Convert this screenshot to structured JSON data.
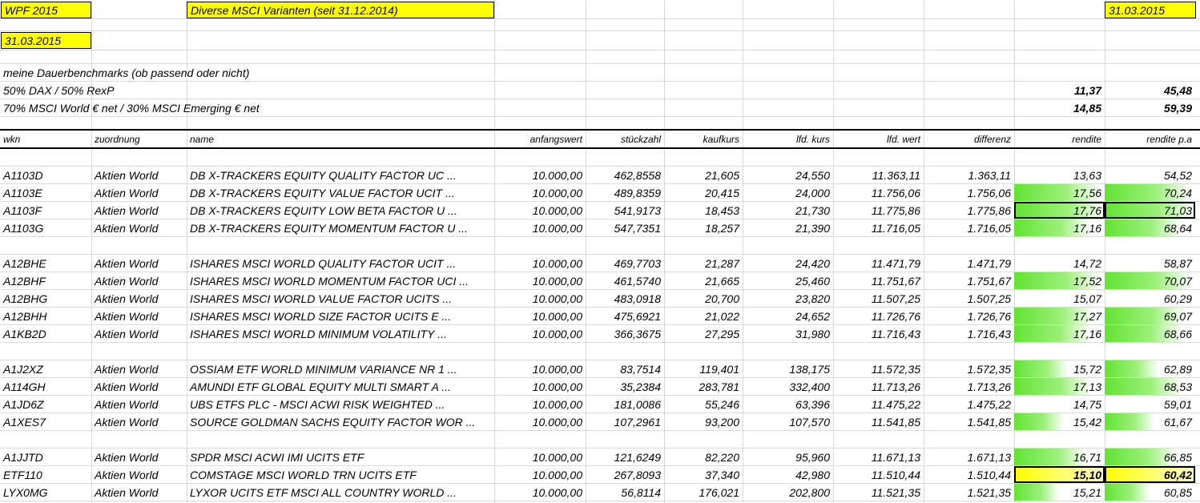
{
  "top": {
    "title": "WPF 2015",
    "subtitle": "Diverse MSCI Varianten (seit 31.12.2014)",
    "date_right": "31.03.2015",
    "date_left": "31.03.2015"
  },
  "benchmarks": {
    "heading": "meine Dauerbenchmarks (ob passend oder nicht)",
    "items": [
      {
        "label": "50% DAX / 50% RexP",
        "rendite": "11,37",
        "rendite_pa": "45,48"
      },
      {
        "label": "70% MSCI World € net / 30% MSCI Emerging € net",
        "rendite": "14,85",
        "rendite_pa": "59,39"
      }
    ]
  },
  "columns": {
    "wkn": "wkn",
    "zuordnung": "zuordnung",
    "name": "name",
    "anfangswert": "anfangswert",
    "stueckzahl": "stückzahl",
    "kaufkurs": "kaufkurs",
    "lfd_kurs": "lfd. kurs",
    "lfd_wert": "lfd. wert",
    "differenz": "differenz",
    "rendite": "rendite",
    "rendite_pa": "rendite p.a"
  },
  "rows": [
    {
      "wkn": "A1103D",
      "zuordnung": "Aktien World",
      "name": "DB X-TRACKERS EQUITY QUALITY FACTOR UC ...",
      "anfangswert": "10.000,00",
      "stueck": "462,8558",
      "kaufkurs": "21,605",
      "lfdkurs": "24,550",
      "lfdwert": "11.363,11",
      "diff": "1.363,11",
      "rendite": "13,63",
      "renditepa": "54,52",
      "fill": 0
    },
    {
      "wkn": "A1103E",
      "zuordnung": "Aktien World",
      "name": "DB X-TRACKERS EQUITY VALUE FACTOR UCIT ...",
      "anfangswert": "10.000,00",
      "stueck": "489,8359",
      "kaufkurs": "20,415",
      "lfdkurs": "24,000",
      "lfdwert": "11.756,06",
      "diff": "1.756,06",
      "rendite": "17,56",
      "renditepa": "70,24",
      "fill": 0.95
    },
    {
      "wkn": "A1103F",
      "zuordnung": "Aktien World",
      "name": "DB X-TRACKERS EQUITY LOW BETA FACTOR U ...",
      "anfangswert": "10.000,00",
      "stueck": "541,9173",
      "kaufkurs": "18,453",
      "lfdkurs": "21,730",
      "lfdwert": "11.775,86",
      "diff": "1.775,86",
      "rendite": "17,76",
      "renditepa": "71,03",
      "fill": 1
    },
    {
      "wkn": "A1103G",
      "zuordnung": "Aktien World",
      "name": "DB X-TRACKERS EQUITY MOMENTUM FACTOR U ...",
      "anfangswert": "10.000,00",
      "stueck": "547,7351",
      "kaufkurs": "18,257",
      "lfdkurs": "21,390",
      "lfdwert": "11.716,05",
      "diff": "1.716,05",
      "rendite": "17,16",
      "renditepa": "68,64",
      "fill": 0.85
    },
    null,
    {
      "wkn": "A12BHE",
      "zuordnung": "Aktien World",
      "name": "ISHARES MSCI WORLD QUALITY FACTOR UCIT ...",
      "anfangswert": "10.000,00",
      "stueck": "469,7703",
      "kaufkurs": "21,287",
      "lfdkurs": "24,420",
      "lfdwert": "11.471,79",
      "diff": "1.471,79",
      "rendite": "14,72",
      "renditepa": "58,87",
      "fill": 0
    },
    {
      "wkn": "A12BHF",
      "zuordnung": "Aktien World",
      "name": "ISHARES MSCI WORLD MOMENTUM FACTOR UCI ...",
      "anfangswert": "10.000,00",
      "stueck": "461,5740",
      "kaufkurs": "21,665",
      "lfdkurs": "25,460",
      "lfdwert": "11.751,67",
      "diff": "1.751,67",
      "rendite": "17,52",
      "renditepa": "70,07",
      "fill": 0.95
    },
    {
      "wkn": "A12BHG",
      "zuordnung": "Aktien World",
      "name": "ISHARES MSCI WORLD VALUE FACTOR UCITS ...",
      "anfangswert": "10.000,00",
      "stueck": "483,0918",
      "kaufkurs": "20,700",
      "lfdkurs": "23,820",
      "lfdwert": "11.507,25",
      "diff": "1.507,25",
      "rendite": "15,07",
      "renditepa": "60,29",
      "fill": 0
    },
    {
      "wkn": "A12BHH",
      "zuordnung": "Aktien World",
      "name": "ISHARES MSCI WORLD SIZE FACTOR UCITS E ...",
      "anfangswert": "10.000,00",
      "stueck": "475,6921",
      "kaufkurs": "21,022",
      "lfdkurs": "24,652",
      "lfdwert": "11.726,76",
      "diff": "1.726,76",
      "rendite": "17,27",
      "renditepa": "69,07",
      "fill": 0.88
    },
    {
      "wkn": "A1KB2D",
      "zuordnung": "Aktien World",
      "name": "ISHARES MSCI WORLD MINIMUM VOLATILITY ...",
      "anfangswert": "10.000,00",
      "stueck": "366,3675",
      "kaufkurs": "27,295",
      "lfdkurs": "31,980",
      "lfdwert": "11.716,43",
      "diff": "1.716,43",
      "rendite": "17,16",
      "renditepa": "68,66",
      "fill": 0.85
    },
    null,
    {
      "wkn": "A1J2XZ",
      "zuordnung": "Aktien World",
      "name": "OSSIAM ETF WORLD MINIMUM VARIANCE NR 1 ...",
      "anfangswert": "10.000,00",
      "stueck": "83,7514",
      "kaufkurs": "119,401",
      "lfdkurs": "138,175",
      "lfdwert": "11.572,35",
      "diff": "1.572,35",
      "rendite": "15,72",
      "renditepa": "62,89",
      "fill": 0.6
    },
    {
      "wkn": "A114GH",
      "zuordnung": "Aktien World",
      "name": "AMUNDI ETF GLOBAL EQUITY MULTI SMART A ...",
      "anfangswert": "10.000,00",
      "stueck": "35,2384",
      "kaufkurs": "283,781",
      "lfdkurs": "332,400",
      "lfdwert": "11.713,26",
      "diff": "1.713,26",
      "rendite": "17,13",
      "renditepa": "68,53",
      "fill": 0.85
    },
    {
      "wkn": "A1JD6Z",
      "zuordnung": "Aktien World",
      "name": "UBS ETFS PLC - MSCI ACWI RISK WEIGHTED ...",
      "anfangswert": "10.000,00",
      "stueck": "181,0086",
      "kaufkurs": "55,246",
      "lfdkurs": "63,396",
      "lfdwert": "11.475,22",
      "diff": "1.475,22",
      "rendite": "14,75",
      "renditepa": "59,01",
      "fill": 0
    },
    {
      "wkn": "A1XES7",
      "zuordnung": "Aktien World",
      "name": "SOURCE GOLDMAN SACHS EQUITY FACTOR WOR ...",
      "anfangswert": "10.000,00",
      "stueck": "107,2961",
      "kaufkurs": "93,200",
      "lfdkurs": "107,570",
      "lfdwert": "11.541,85",
      "diff": "1.541,85",
      "rendite": "15,42",
      "renditepa": "61,67",
      "fill": 0.55
    },
    null,
    {
      "wkn": "A1JJTD",
      "zuordnung": "Aktien World",
      "name": "SPDR MSCI ACWI IMI UCITS ETF",
      "anfangswert": "10.000,00",
      "stueck": "121,6249",
      "kaufkurs": "82,220",
      "lfdkurs": "95,960",
      "lfdwert": "11.671,13",
      "diff": "1.671,13",
      "rendite": "16,71",
      "renditepa": "66,85",
      "fill": 0.8
    },
    {
      "wkn": "ETF110",
      "zuordnung": "Aktien World",
      "name": "COMSTAGE MSCI WORLD TRN UCITS ETF",
      "anfangswert": "10.000,00",
      "stueck": "267,8093",
      "kaufkurs": "37,340",
      "lfdkurs": "42,980",
      "lfdwert": "11.510,44",
      "diff": "1.510,44",
      "rendite": "15,10",
      "renditepa": "60,42",
      "fill": -1
    },
    {
      "wkn": "LYX0MG",
      "zuordnung": "Aktien World",
      "name": "LYXOR UCITS ETF MSCI ALL COUNTRY WORLD ...",
      "anfangswert": "10.000,00",
      "stueck": "56,8114",
      "kaufkurs": "176,021",
      "lfdkurs": "202,800",
      "lfdwert": "11.521,35",
      "diff": "1.521,35",
      "rendite": "15,21",
      "renditepa": "60,85",
      "fill": 0.5
    }
  ]
}
